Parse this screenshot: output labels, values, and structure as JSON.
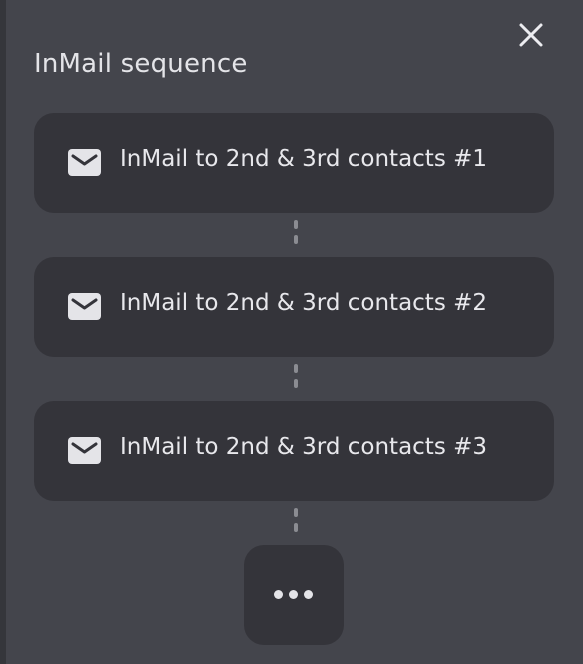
{
  "panel": {
    "title": "InMail sequence",
    "close_icon": "close-icon"
  },
  "steps": [
    {
      "icon": "mail-icon",
      "label": "InMail to 2nd & 3rd contacts #1"
    },
    {
      "icon": "mail-icon",
      "label": "InMail to 2nd & 3rd contacts #2"
    },
    {
      "icon": "mail-icon",
      "label": "InMail to 2nd & 3rd contacts #3"
    }
  ],
  "more_button": {
    "icon": "more-horizontal-icon"
  },
  "colors": {
    "panel_bg": "#44454c",
    "card_bg": "#34343a",
    "text": "#e8e8ec",
    "connector": "#8b8c92"
  }
}
